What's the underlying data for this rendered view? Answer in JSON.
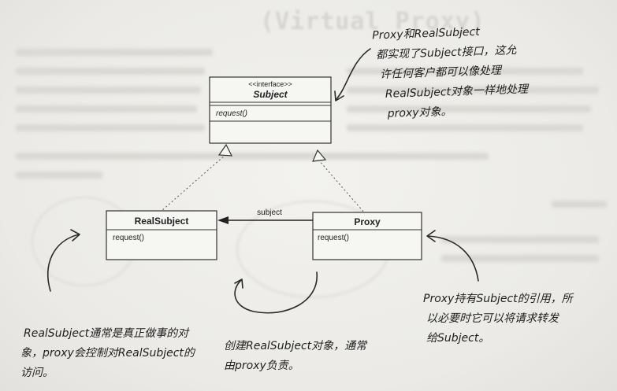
{
  "page": {
    "faded_title": "(Virtual Proxy)"
  },
  "diagram": {
    "subject": {
      "stereotype": "<<interface>>",
      "name": "Subject",
      "method": "request()"
    },
    "real_subject": {
      "name": "RealSubject",
      "method": "request()"
    },
    "proxy": {
      "name": "Proxy",
      "method": "request()"
    },
    "association_label": "subject"
  },
  "annotations": {
    "top_right": [
      "Proxy和RealSubject",
      "都实现了Subject接口，这允",
      "许任何客户都可以像处理",
      "RealSubject对象一样地处理",
      "proxy对象。"
    ],
    "bottom_left": [
      "RealSubject通常是真正做事的对",
      "象，proxy会控制对RealSubject的",
      "访问。"
    ],
    "bottom_middle": [
      "创建RealSubject对象，通常",
      "由proxy负责。"
    ],
    "bottom_right": [
      "Proxy持有Subject的引用，所",
      "以必要时它可以将请求转发",
      "给Subject。"
    ]
  },
  "colors": {
    "paper": "#ecebe8",
    "ink": "#222222",
    "faded": "#d9d8d4"
  }
}
